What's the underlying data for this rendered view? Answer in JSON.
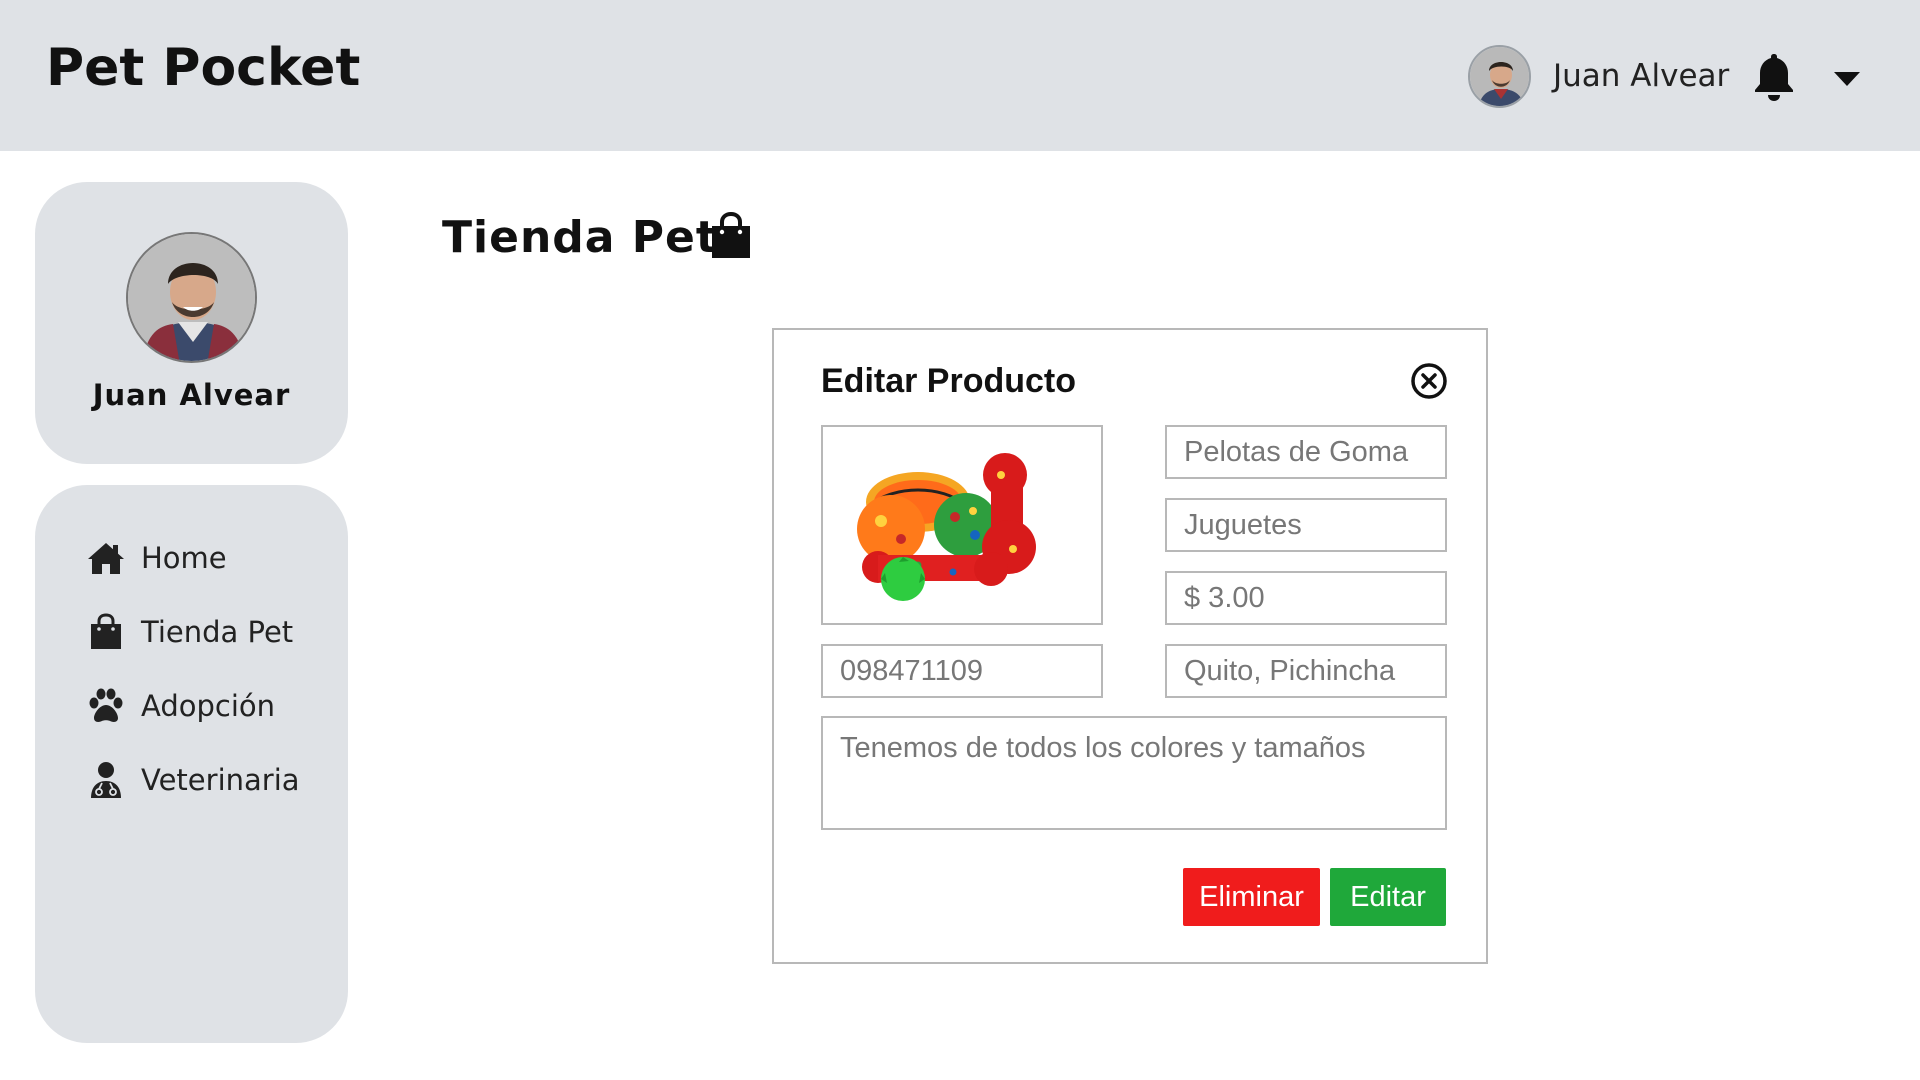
{
  "header": {
    "app_title": "Pet Pocket",
    "user_name": "Juan Alvear",
    "bell_icon": "bell-icon",
    "menu_icon": "caret-down-icon"
  },
  "profile": {
    "name": "Juan Alvear"
  },
  "sidebar": {
    "items": [
      {
        "label": "Home",
        "icon": "home-icon"
      },
      {
        "label": "Tienda Pet",
        "icon": "shopping-bag-icon"
      },
      {
        "label": "Adopción",
        "icon": "paw-icon"
      },
      {
        "label": "Veterinaria",
        "icon": "doctor-icon"
      }
    ]
  },
  "main": {
    "title": "Tienda Pet",
    "title_icon": "shopping-bag-icon"
  },
  "modal": {
    "title": "Editar Producto",
    "close_icon": "close-circle-icon",
    "fields": {
      "name": "Pelotas de Goma",
      "category": "Juguetes",
      "price": "$ 3.00",
      "phone": "098471109",
      "location": "Quito, Pichincha",
      "description": "Tenemos de todos los colores y tamaños"
    },
    "delete_label": "Eliminar",
    "edit_label": "Editar"
  },
  "colors": {
    "header_bg": "#dfe2e6",
    "card_bg": "#dfe2e6",
    "delete": "#f01c1c",
    "edit": "#1fa83a",
    "border": "#b8b8b8"
  }
}
